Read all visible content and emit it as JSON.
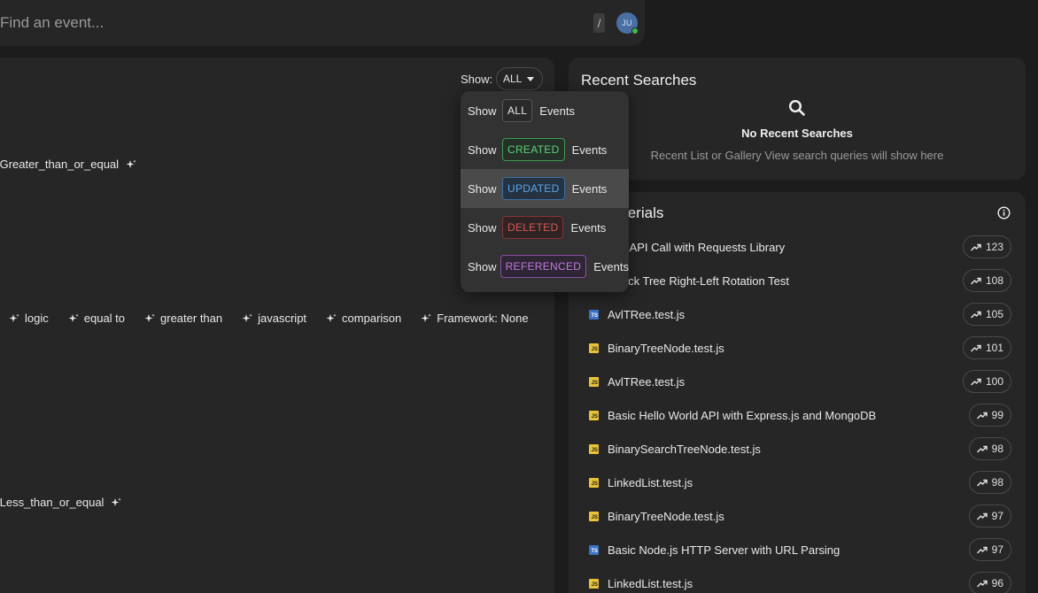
{
  "search": {
    "placeholder": "Find an event...",
    "shortcut": "/"
  },
  "user": {
    "initials": "JU",
    "status_color": "#3fb950"
  },
  "events_panel": {
    "show_label": "Show:",
    "show_value": "ALL",
    "event_titles": [
      "/Greater_than_or_equal",
      "/Less_than_or_equal"
    ],
    "tags": [
      "logic",
      "equal to",
      "greater than",
      "javascript",
      "comparison",
      "Framework: None"
    ]
  },
  "filter_dropdown": {
    "prefix": "Show",
    "suffix": "Events",
    "items": [
      {
        "label": "ALL",
        "kind": "all"
      },
      {
        "label": "CREATED",
        "kind": "created"
      },
      {
        "label": "UPDATED",
        "kind": "updated"
      },
      {
        "label": "DELETED",
        "kind": "deleted"
      },
      {
        "label": "REFERENCED",
        "kind": "referenced"
      }
    ],
    "highlighted": "UPDATED"
  },
  "recent_searches": {
    "title": "Recent Searches",
    "empty_title": "No Recent Searches",
    "empty_subtitle": "Recent List or Gallery View search queries will show here"
  },
  "materials": {
    "title": "terials",
    "items": [
      {
        "name": "hon API Call with Requests Library",
        "icon": "none",
        "count": "123"
      },
      {
        "name": "-Black Tree Right-Left Rotation Test",
        "icon": "none",
        "count": "108"
      },
      {
        "name": "AvlTRee.test.js",
        "icon": "ts",
        "count": "105"
      },
      {
        "name": "BinaryTreeNode.test.js",
        "icon": "js",
        "count": "101"
      },
      {
        "name": "AvlTRee.test.js",
        "icon": "js",
        "count": "100"
      },
      {
        "name": "Basic Hello World API with Express.js and MongoDB",
        "icon": "js",
        "count": "99"
      },
      {
        "name": "BinarySearchTreeNode.test.js",
        "icon": "js",
        "count": "98"
      },
      {
        "name": "LinkedList.test.js",
        "icon": "js",
        "count": "98"
      },
      {
        "name": "BinaryTreeNode.test.js",
        "icon": "js",
        "count": "97"
      },
      {
        "name": "Basic Node.js HTTP Server with URL Parsing",
        "icon": "ts",
        "count": "97"
      },
      {
        "name": "LinkedList.test.js",
        "icon": "js",
        "count": "96"
      }
    ]
  },
  "colors": {
    "background": "#1c1c1c",
    "panel": "#262626",
    "created": "#5fd07a",
    "updated": "#5ea6e8",
    "deleted": "#d95757",
    "referenced": "#c27ae0",
    "js_icon": "#e8c33a",
    "ts_icon": "#3b72c4"
  }
}
